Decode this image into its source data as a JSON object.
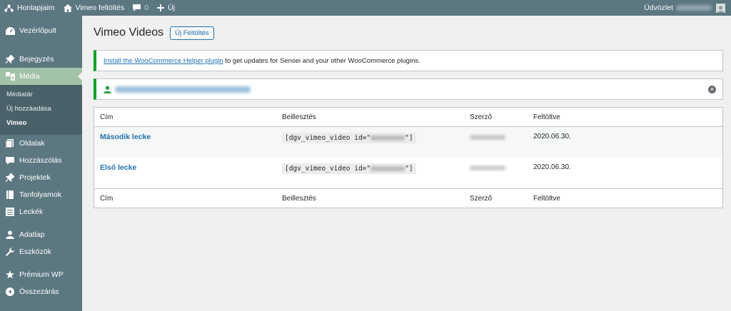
{
  "adminbar": {
    "site_name": "Honlapjaim",
    "site_link": "Vimeo feltöltés",
    "comments_count": "0",
    "new_label": "Új",
    "greeting": "Üdvözlet"
  },
  "sidebar": {
    "items": [
      {
        "label": "Vezérlőpult",
        "icon": "dashboard-icon"
      },
      {
        "label": "Bejegyzés",
        "icon": "pin-icon"
      },
      {
        "label": "Média",
        "icon": "media-icon"
      },
      {
        "label": "Oldalak",
        "icon": "pages-icon"
      },
      {
        "label": "Hozzászólás",
        "icon": "comment-icon"
      },
      {
        "label": "Projektek",
        "icon": "pin-icon"
      },
      {
        "label": "Tanfolyamok",
        "icon": "book-icon"
      },
      {
        "label": "Leckék",
        "icon": "list-icon"
      },
      {
        "label": "Adatlap",
        "icon": "user-icon"
      },
      {
        "label": "Eszközök",
        "icon": "wrench-icon"
      },
      {
        "label": "Prémium WP",
        "icon": "star-icon"
      },
      {
        "label": "Összezárás",
        "icon": "collapse-icon"
      }
    ],
    "submenu": [
      "Médiatár",
      "Új hozzáadása",
      "Vimeo"
    ]
  },
  "page": {
    "title": "Vimeo Videos",
    "add_button": "Új Feltöltés"
  },
  "notice": {
    "link_text": "Install the WooCommerce Helper plugin",
    "text": " to get updates for Sensei and your other WooCommerce plugins."
  },
  "table": {
    "headers": [
      "Cím",
      "Beillesztés",
      "Szerző",
      "Feltöltve"
    ],
    "rows": [
      {
        "title": "Második lecke",
        "code_prefix": "[dgv_vimeo_video id=\"",
        "code_suffix": "\"]",
        "date": "2020.06.30."
      },
      {
        "title": "Első lecke",
        "code_prefix": "[dgv_vimeo_video id=\"",
        "code_suffix": "\"]",
        "date": "2020.06.30."
      }
    ]
  },
  "colors": {
    "sidebar_bg": "#5b7780",
    "active_menu": "#a2c3a7",
    "link": "#2271b1",
    "notice_border": "#00a32a"
  }
}
